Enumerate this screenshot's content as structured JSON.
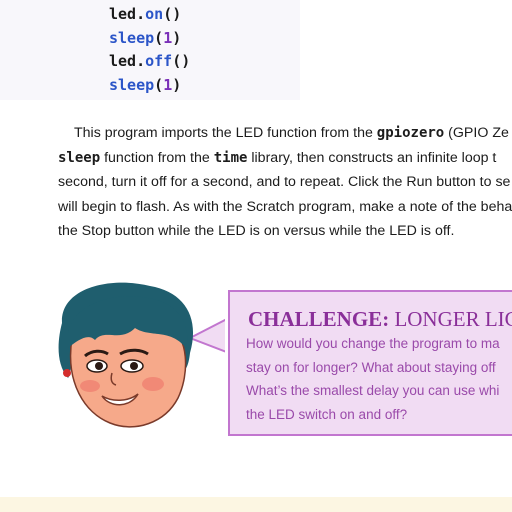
{
  "code": [
    {
      "obj": "led.",
      "method": "on",
      "args": "()"
    },
    {
      "fn": "sleep",
      "open": "(",
      "arg": "1",
      "close": ")"
    },
    {
      "obj": "led.",
      "method": "off",
      "args": "()"
    },
    {
      "fn": "sleep",
      "open": "(",
      "arg": "1",
      "close": ")"
    }
  ],
  "paragraph": {
    "l1_a": "This program imports the LED function from the ",
    "l1_code": "gpiozero",
    "l1_b": " (GPIO Ze",
    "l2_code1": "sleep",
    "l2_a": " function from the ",
    "l2_code2": "time",
    "l2_b": " library, then constructs an infinite loop t",
    "l3": "second, turn it off for a second, and to repeat. Click the Run button to se",
    "l4": "will begin to flash. As with the Scratch program, make a note of the beha",
    "l5": "the Stop button while the LED is on versus while the LED is off."
  },
  "challenge": {
    "title_bold": "CHALLENGE:",
    "title_rest": " LONGER LIGHT",
    "lines": [
      "How would you change the program to ma",
      "stay on for longer? What about staying off",
      "What’s the smallest delay you can use whi",
      "the LED switch on and off?"
    ]
  },
  "colors": {
    "challenge_bg": "#f1dcf3",
    "challenge_border": "#c276cf",
    "challenge_title": "#8a2f99",
    "challenge_text": "#9a4aaa",
    "code_keyword": "#2b55c8",
    "code_number": "#7a2fb8"
  }
}
